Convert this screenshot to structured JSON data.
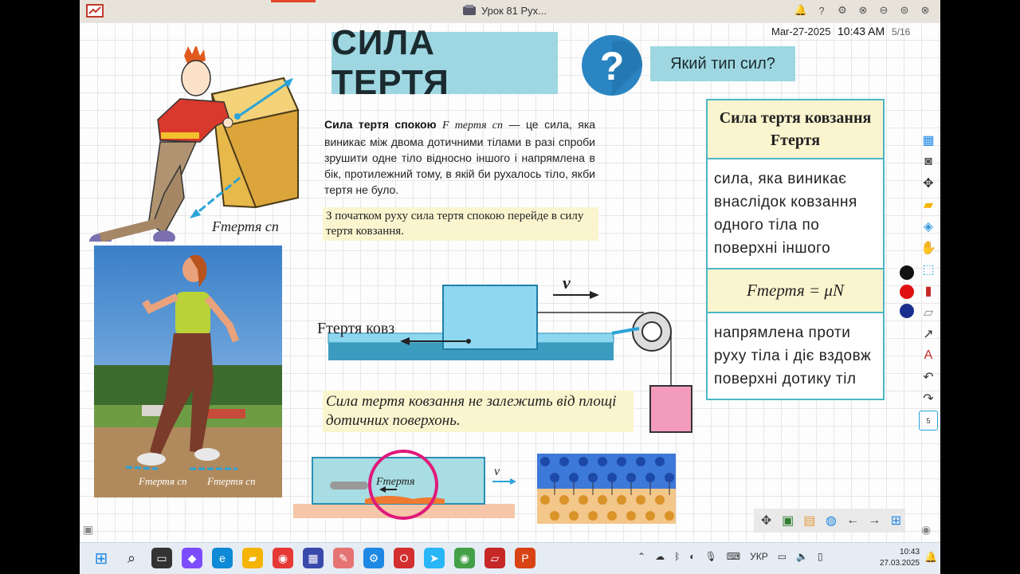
{
  "window": {
    "title": "Урок 81 Рух..."
  },
  "board": {
    "date": "Mar-27-2025",
    "time": "10:43 AM",
    "page": "5/16",
    "title": "СИЛА ТЕРТЯ",
    "question": "Який тип сил?",
    "definition": {
      "term": "Сила тертя спокою",
      "symbol": "F тертя сп",
      "text": " — це сила, яка виникає між двома дотичними тілами в разі спроби зрушити одне тіло відносно іншого і напрямлена в бік, протилежний тому, в якій би рухалось тіло, якби тертя не було."
    },
    "note_start": "З початком руху сила тертя спокою перейде в силу тертя ковзання.",
    "note_area": "Сила тертя ковзання не залежить від площі дотичних поверхонь.",
    "figure_labels": {
      "force": "F",
      "friction_static": "Fтертя сп",
      "friction_slide": "Fтертя ковз",
      "velocity": "v",
      "friction": "Fтертя"
    }
  },
  "table": {
    "header": "Сила тертя ковзання Fтертя",
    "definition": "сила, яка виникає внаслідок ковзання одного тіла по поверхні іншого",
    "formula": "Fтертя = μN",
    "direction": "напрямлена проти руху тіла і діє вздовж поверхні дотику тіл"
  },
  "toolbar": {
    "page_badge": "5"
  },
  "taskbar": {
    "language": "УКР",
    "clock_time": "10:43",
    "clock_date": "27.03.2025"
  },
  "colors": {
    "accent": "#9ed7e1",
    "note": "#fbf5cf",
    "border": "#4cb6c6"
  }
}
